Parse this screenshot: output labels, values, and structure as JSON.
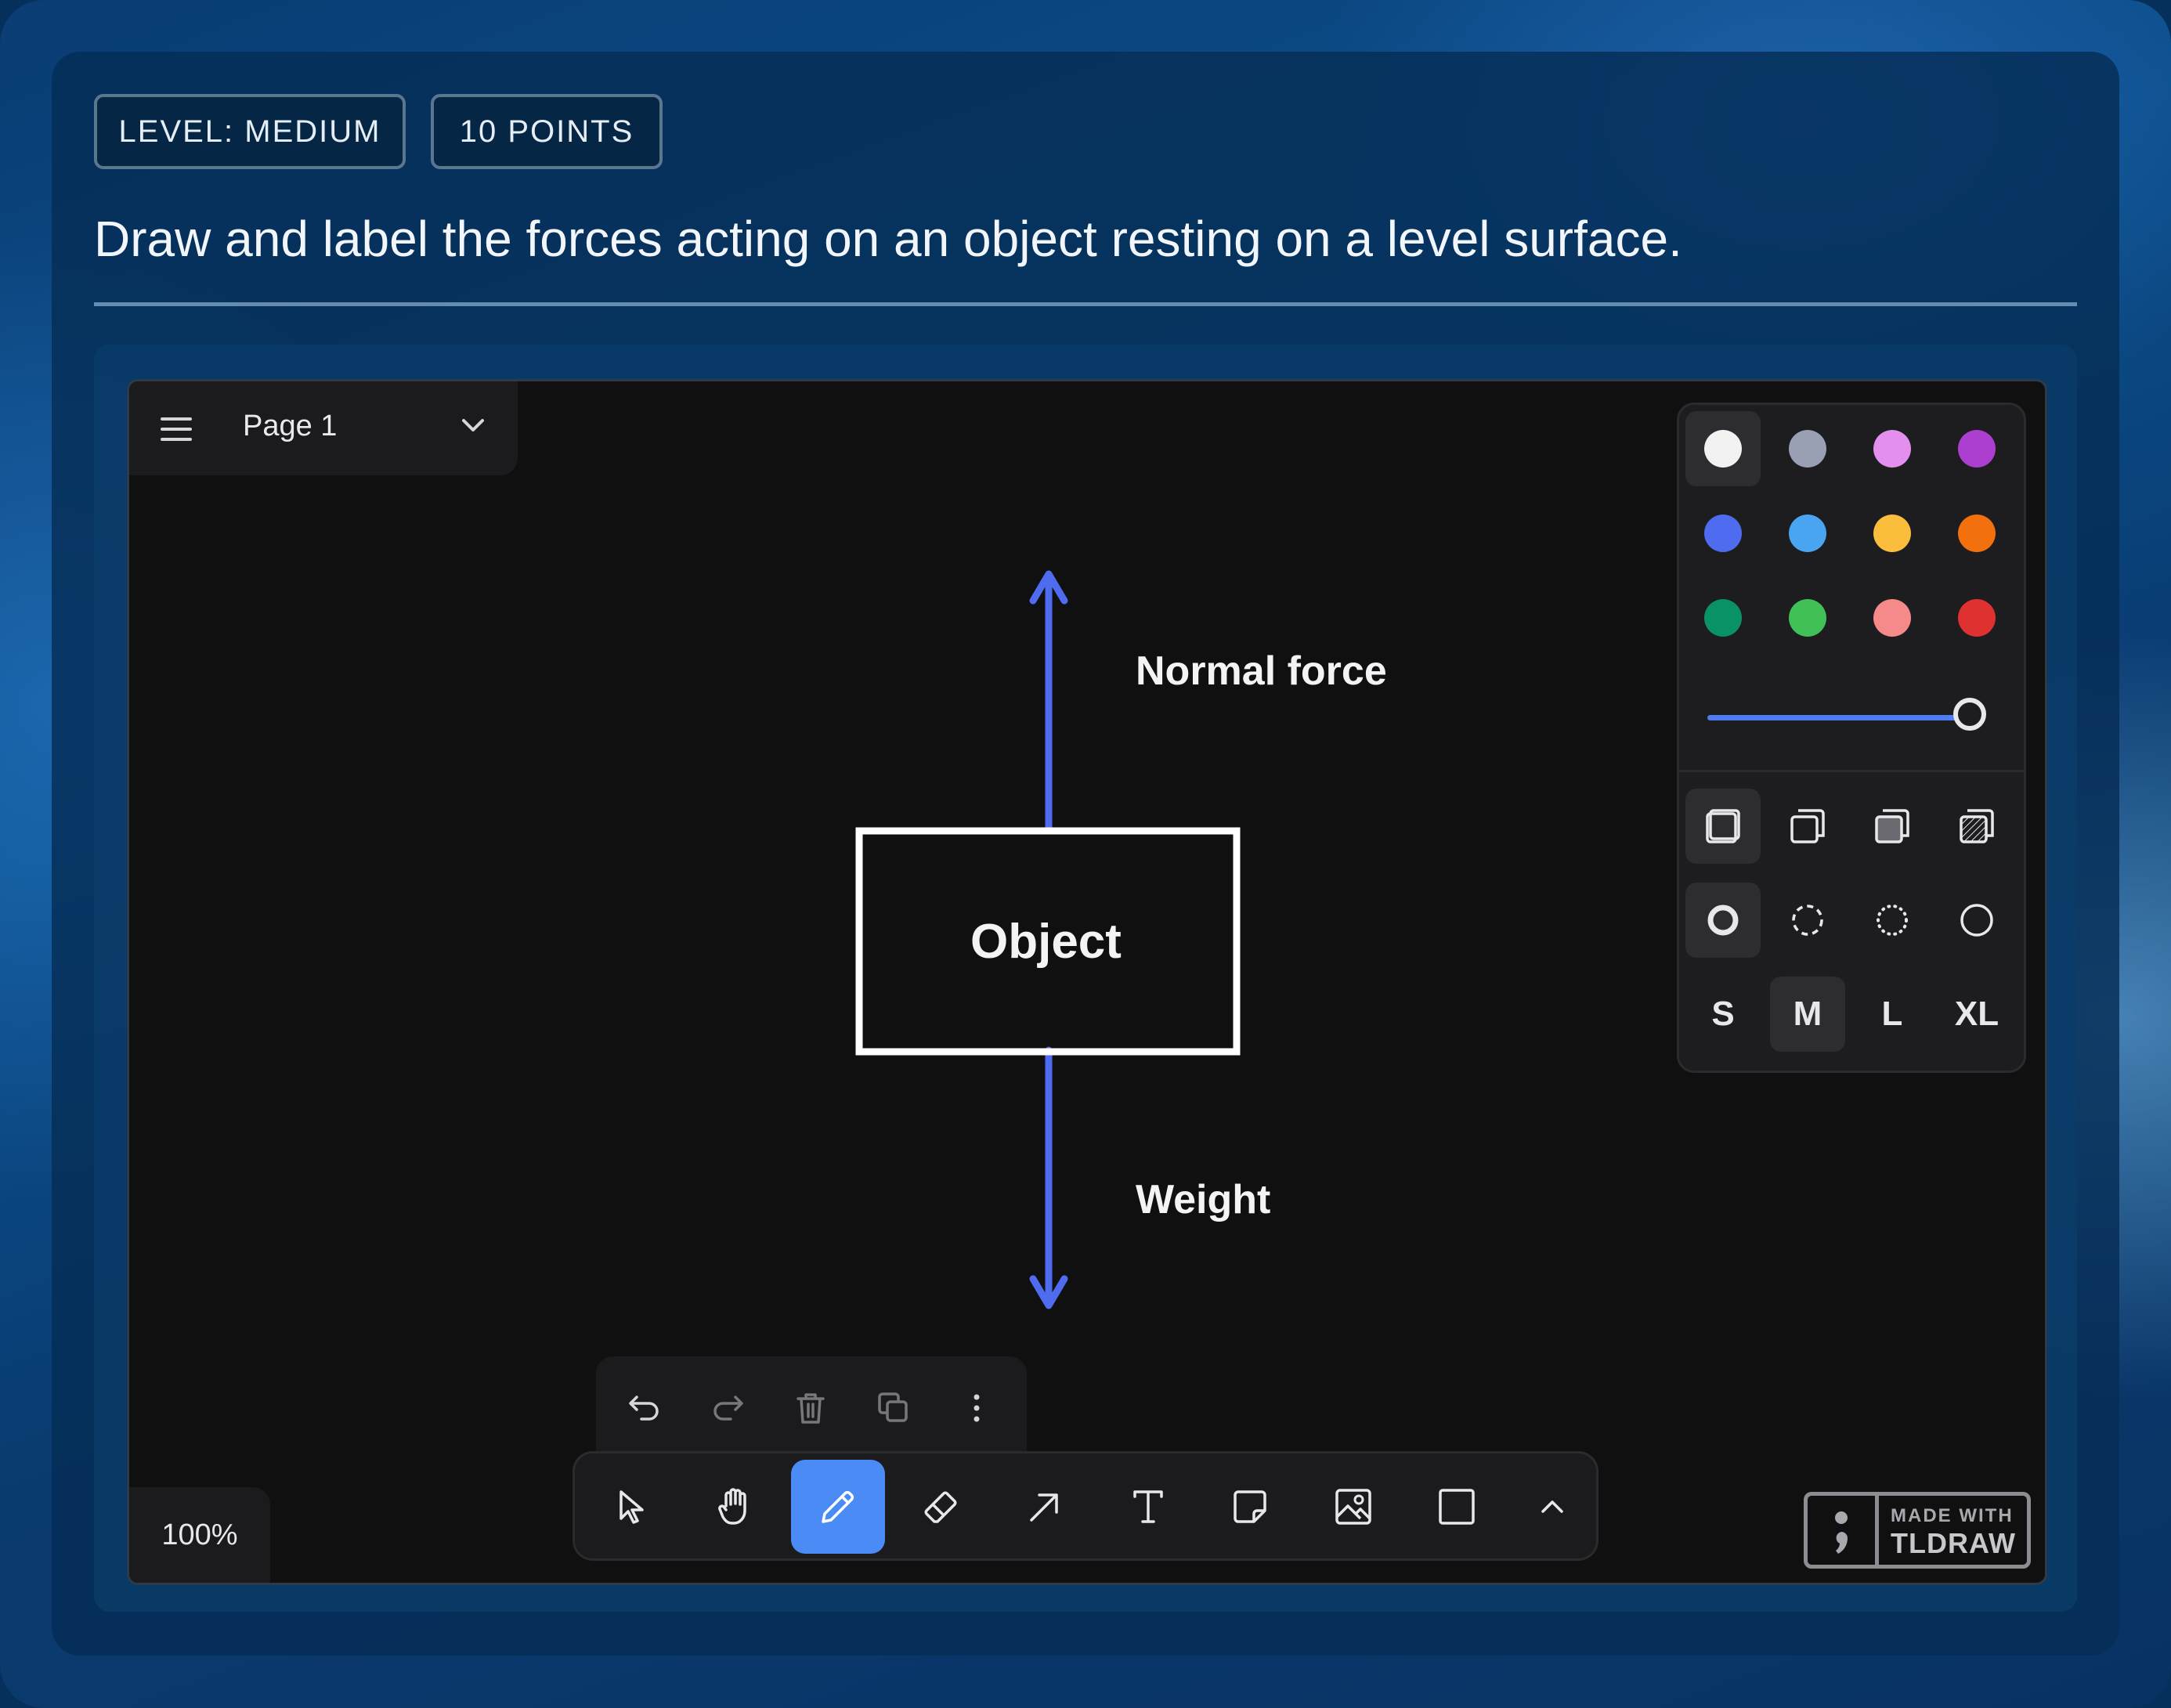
{
  "header": {
    "level_badge": "LEVEL:  MEDIUM",
    "points_badge": "10  POINTS",
    "question": "Draw and label the forces acting on an object resting on a level surface."
  },
  "editor": {
    "page_menu": {
      "label": "Page 1",
      "icon": "hamburger-menu-icon",
      "dropdown_icon": "chevron-down-icon"
    },
    "zoom": "100%",
    "diagram": {
      "box_label": "Object",
      "up_arrow_label": "Normal force",
      "down_arrow_label": "Weight",
      "arrow_color": "#4f6cf0",
      "box_color": "#ffffff"
    },
    "style_panel": {
      "colors": [
        "#f2f2f2",
        "#9aa0b4",
        "#e48ef0",
        "#ad3fd0",
        "#4f6cf0",
        "#49a5f2",
        "#fbbd3c",
        "#f2700e",
        "#099268",
        "#40c057",
        "#f58a8a",
        "#e03131"
      ],
      "selected_color_index": 0,
      "opacity_level": 1.0,
      "fill_options": [
        "fill-none-icon",
        "fill-semi-icon",
        "fill-solid-icon",
        "fill-pattern-icon"
      ],
      "selected_fill_index": 0,
      "dash_options": [
        "dash-draw-icon",
        "dash-dashed-icon",
        "dash-dotted-icon",
        "dash-solid-icon"
      ],
      "selected_dash_index": 0,
      "sizes": [
        "S",
        "M",
        "L",
        "XL"
      ],
      "selected_size_index": 1
    },
    "action_bar": [
      "undo-icon",
      "redo-icon",
      "trash-icon",
      "duplicate-icon",
      "more-vertical-icon"
    ],
    "toolbar": {
      "tools": [
        "select-icon",
        "hand-icon",
        "pencil-icon",
        "eraser-icon",
        "arrow-icon",
        "text-icon",
        "note-icon",
        "image-icon",
        "rectangle-icon",
        "chevron-up-icon"
      ],
      "active_tool_index": 2
    },
    "watermark": {
      "line1": "MADE WITH",
      "line2": "TLDRAW"
    }
  }
}
